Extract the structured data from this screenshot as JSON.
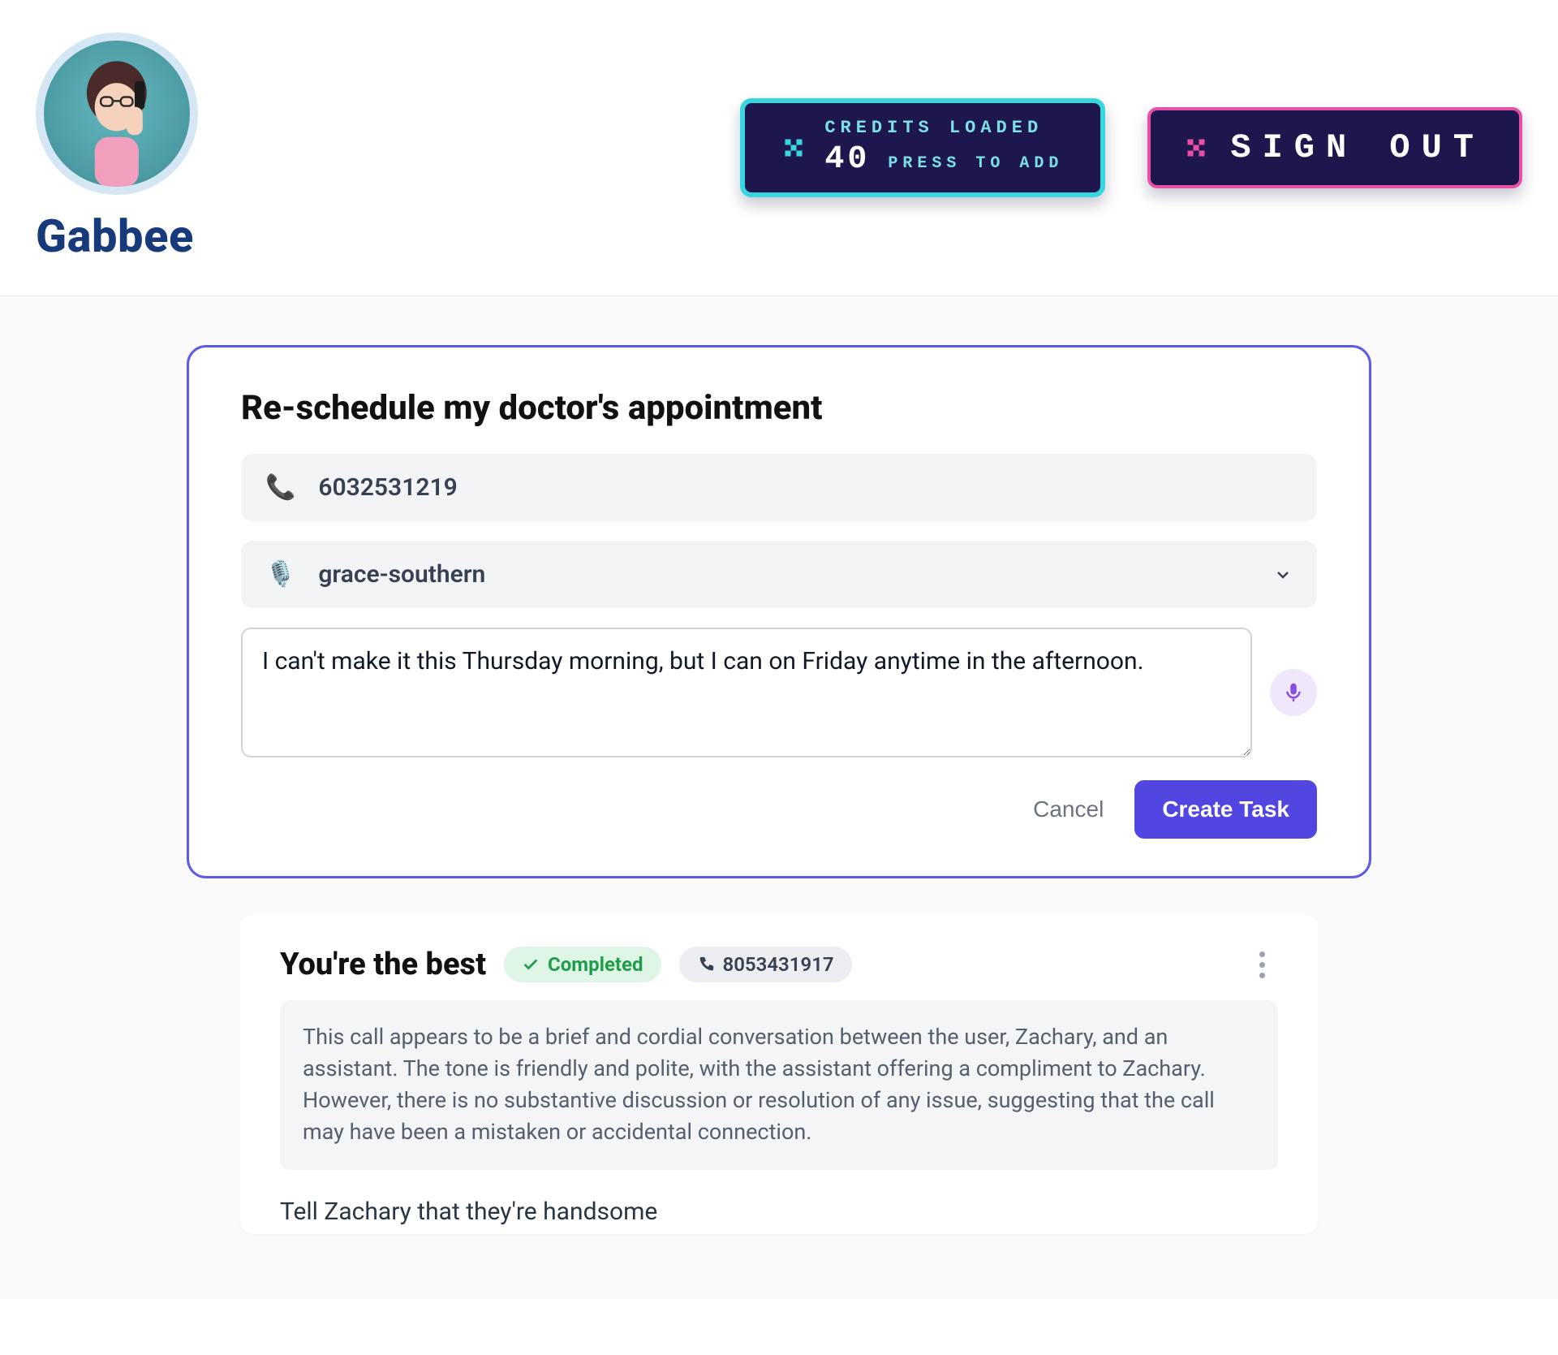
{
  "brand": {
    "name": "Gabbee"
  },
  "header": {
    "credits": {
      "line1": "CREDITS LOADED",
      "count": "40",
      "sub": "PRESS TO ADD"
    },
    "signout_label": "SIGN OUT"
  },
  "new_task": {
    "title": "Re-schedule my doctor's appointment",
    "phone": "6032531219",
    "voice": "grace-southern",
    "notes": "I can't make it this Thursday morning, but I can on Friday anytime in the afternoon.",
    "cancel_label": "Cancel",
    "create_label": "Create Task"
  },
  "task": {
    "title": "You're the best",
    "status": "Completed",
    "phone": "8053431917",
    "summary": "This call appears to be a brief and cordial conversation between the user, Zachary, and an assistant. The tone is friendly and polite, with the assistant offering a compliment to Zachary. However, there is no substantive discussion or resolution of any issue, suggesting that the call may have been a mistaken or accidental connection.",
    "instruction": "Tell Zachary that they're handsome"
  }
}
